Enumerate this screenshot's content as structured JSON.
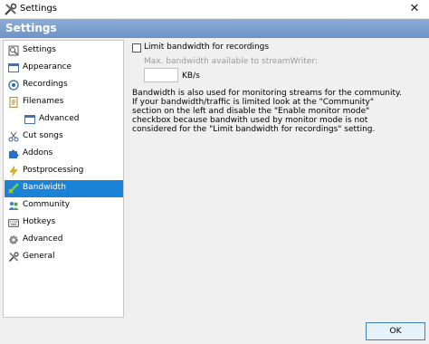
{
  "window": {
    "title": "Settings",
    "close_glyph": "✕",
    "app_icon": "tools-icon"
  },
  "header": {
    "title": "Settings"
  },
  "sidebar": {
    "items": [
      {
        "label": "Settings",
        "icon": "settings-icon"
      },
      {
        "label": "Appearance",
        "icon": "appearance-icon"
      },
      {
        "label": "Recordings",
        "icon": "recordings-icon"
      },
      {
        "label": "Filenames",
        "icon": "filenames-icon"
      },
      {
        "label": "Advanced",
        "icon": "advanced-icon"
      },
      {
        "label": "Cut songs",
        "icon": "scissors-icon"
      },
      {
        "label": "Addons",
        "icon": "puzzle-icon"
      },
      {
        "label": "Postprocessing",
        "icon": "lightning-icon"
      },
      {
        "label": "Bandwidth",
        "icon": "bandwidth-icon",
        "selected": true
      },
      {
        "label": "Community",
        "icon": "community-icon"
      },
      {
        "label": "Hotkeys",
        "icon": "keyboard-icon"
      },
      {
        "label": "Advanced",
        "icon": "gear-icon"
      },
      {
        "label": "General",
        "icon": "tools-icon"
      }
    ]
  },
  "bandwidth": {
    "limit_checkbox_label": "Limit bandwidth for recordings",
    "limit_checked": false,
    "max_caption": "Max. bandwidth available to streamWriter:",
    "value": "",
    "unit": "KB/s",
    "info": "Bandwidth is also used for monitoring streams for the community. If your bandwidth/traffic is limited look at the \"Community\" section on the left and disable the \"Enable monitor mode\" checkbox because bandwith used by monitor mode is not considered for the \"Limit bandwidth for recordings\" setting."
  },
  "footer": {
    "ok_label": "OK"
  },
  "colors": {
    "header_band": "#7a9dcc",
    "selection": "#1a83d8"
  }
}
